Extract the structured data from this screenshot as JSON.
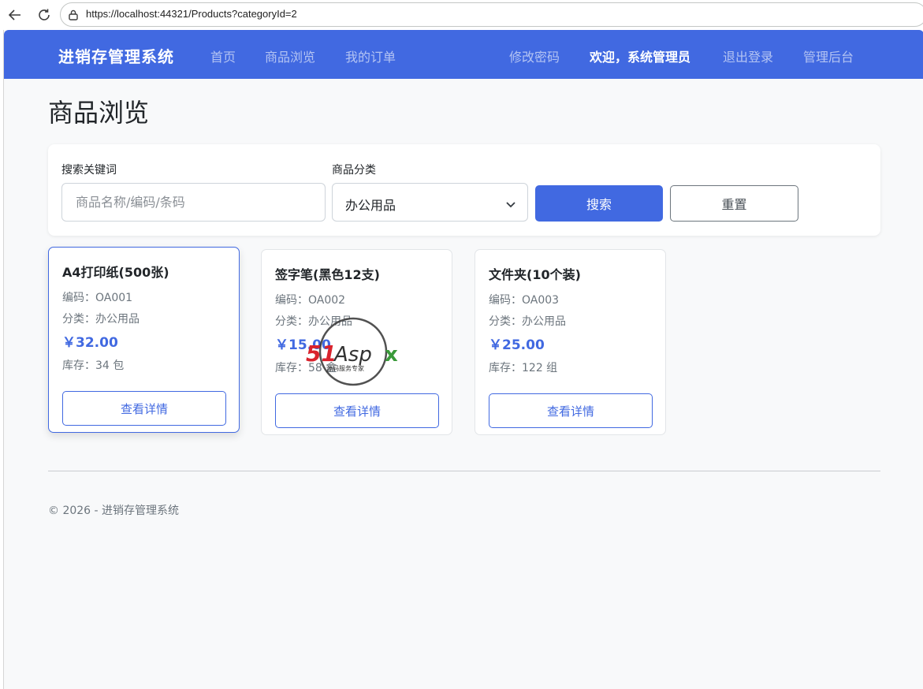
{
  "browser": {
    "url": "https://localhost:44321/Products?categoryId=2"
  },
  "navbar": {
    "brand": "进销存管理系统",
    "links": [
      {
        "label": "首页"
      },
      {
        "label": "商品浏览"
      },
      {
        "label": "我的订单"
      }
    ],
    "right_links": [
      {
        "label": "修改密码"
      },
      {
        "label": "欢迎，系统管理员"
      },
      {
        "label": "退出登录"
      },
      {
        "label": "管理后台"
      }
    ]
  },
  "page": {
    "title": "商品浏览"
  },
  "search": {
    "keyword_label": "搜索关键词",
    "keyword_placeholder": "商品名称/编码/条码",
    "keyword_value": "",
    "category_label": "商品分类",
    "category_value": "办公用品",
    "search_button": "搜索",
    "reset_button": "重置"
  },
  "products": [
    {
      "name": "A4打印纸(500张)",
      "code": "编码：OA001",
      "category": "分类：办公用品",
      "price": "￥32.00",
      "stock": "库存：34 包",
      "action": "查看详情"
    },
    {
      "name": "签字笔(黑色12支)",
      "code": "编码：OA002",
      "category": "分类：办公用品",
      "price": "￥15.00",
      "stock": "库存：58 盒",
      "action": "查看详情"
    },
    {
      "name": "文件夹(10个装)",
      "code": "编码：OA003",
      "category": "分类：办公用品",
      "price": "￥25.00",
      "stock": "库存：122 组",
      "action": "查看详情"
    }
  ],
  "footer": {
    "text": "© 2026 - 进销存管理系统"
  },
  "watermark": {
    "text": "51Aspx",
    "subtext": "源码服务专家"
  },
  "colors": {
    "primary": "#4169e1",
    "background": "#f8f9fa"
  }
}
